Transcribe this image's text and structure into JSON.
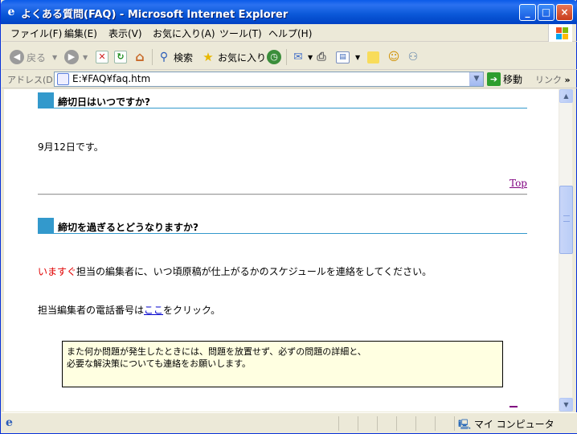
{
  "window": {
    "title": "よくある質問(FAQ) - Microsoft Internet Explorer",
    "minimize": "_",
    "maximize": "□",
    "close": "×"
  },
  "menu": [
    "ファイル(F)",
    "編集(E)",
    "表示(V)",
    "お気に入り(A)",
    "ツール(T)",
    "ヘルプ(H)"
  ],
  "toolbar": {
    "back": "戻る",
    "search": "検索",
    "favorites": "お気に入り"
  },
  "address": {
    "label": "アドレス(D)",
    "url": "E:¥FAQ¥faq.htm",
    "go": "移動",
    "links": "リンク"
  },
  "content": {
    "q1_heading": "締切日はいつですか?",
    "q1_answer": "9月12日です。",
    "top_link": "Top",
    "q2_heading": "締切を過ぎるとどうなりますか?",
    "q2_answer_red": "いますぐ",
    "q2_answer_rest": "担当の編集者に、いつ頃原稿が仕上がるかのスケジュールを連絡をしてください。",
    "phone_prefix": "担当編集者の電話番号は",
    "phone_link": "ここ",
    "phone_suffix": "をクリック。",
    "note_line1": "また何か問題が発生したときには、問題を放置せず、必ずの問題の詳細と、",
    "note_line2": "必要な解決策についても連絡をお願いします。"
  },
  "status": {
    "zone": "マイ コンピュータ"
  }
}
